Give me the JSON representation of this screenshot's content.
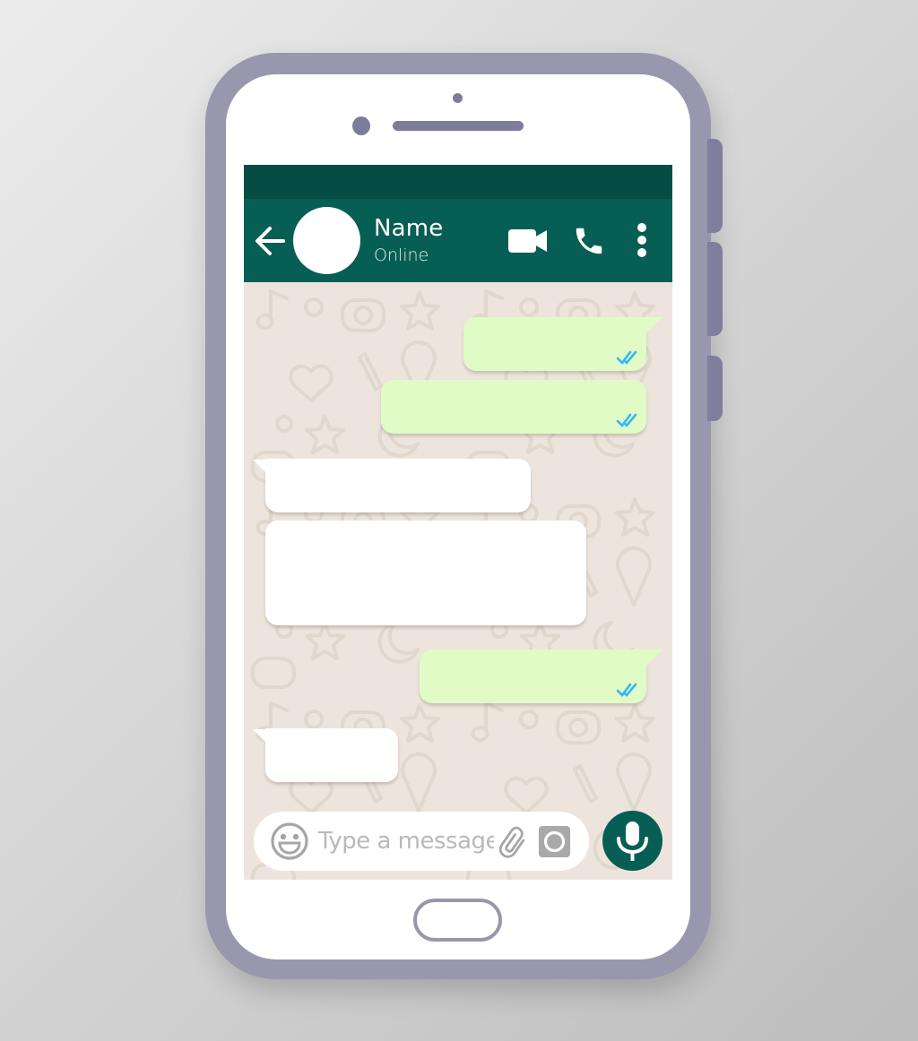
{
  "device": {
    "frame_color": "#9897ad",
    "accent_dark": "#7e7c9b"
  },
  "app": {
    "statusbar_color": "#054d44",
    "header_color": "#075e55",
    "chat_bg_color": "#ede5dd",
    "outgoing_bubble_color": "#e1fbc7",
    "incoming_bubble_color": "#ffffff",
    "read_tick_color": "#34b7f1"
  },
  "header": {
    "back_icon": "arrow-left-icon",
    "contact_name": "Name",
    "contact_status": "Online",
    "actions": [
      {
        "icon": "video-camera-icon",
        "label": "Video call"
      },
      {
        "icon": "phone-icon",
        "label": "Voice call"
      },
      {
        "icon": "more-vertical-icon",
        "label": "More options"
      }
    ]
  },
  "messages": [
    {
      "direction": "outgoing",
      "status": "read",
      "text": ""
    },
    {
      "direction": "outgoing",
      "status": "read",
      "text": ""
    },
    {
      "direction": "incoming",
      "text": ""
    },
    {
      "direction": "incoming",
      "text": ""
    },
    {
      "direction": "outgoing",
      "status": "read",
      "text": ""
    },
    {
      "direction": "incoming",
      "text": ""
    }
  ],
  "composer": {
    "value": "",
    "placeholder": "Type a message",
    "emoji_icon": "emoji-icon",
    "attach_icon": "paperclip-icon",
    "camera_icon": "camera-icon",
    "mic_icon": "microphone-icon"
  }
}
